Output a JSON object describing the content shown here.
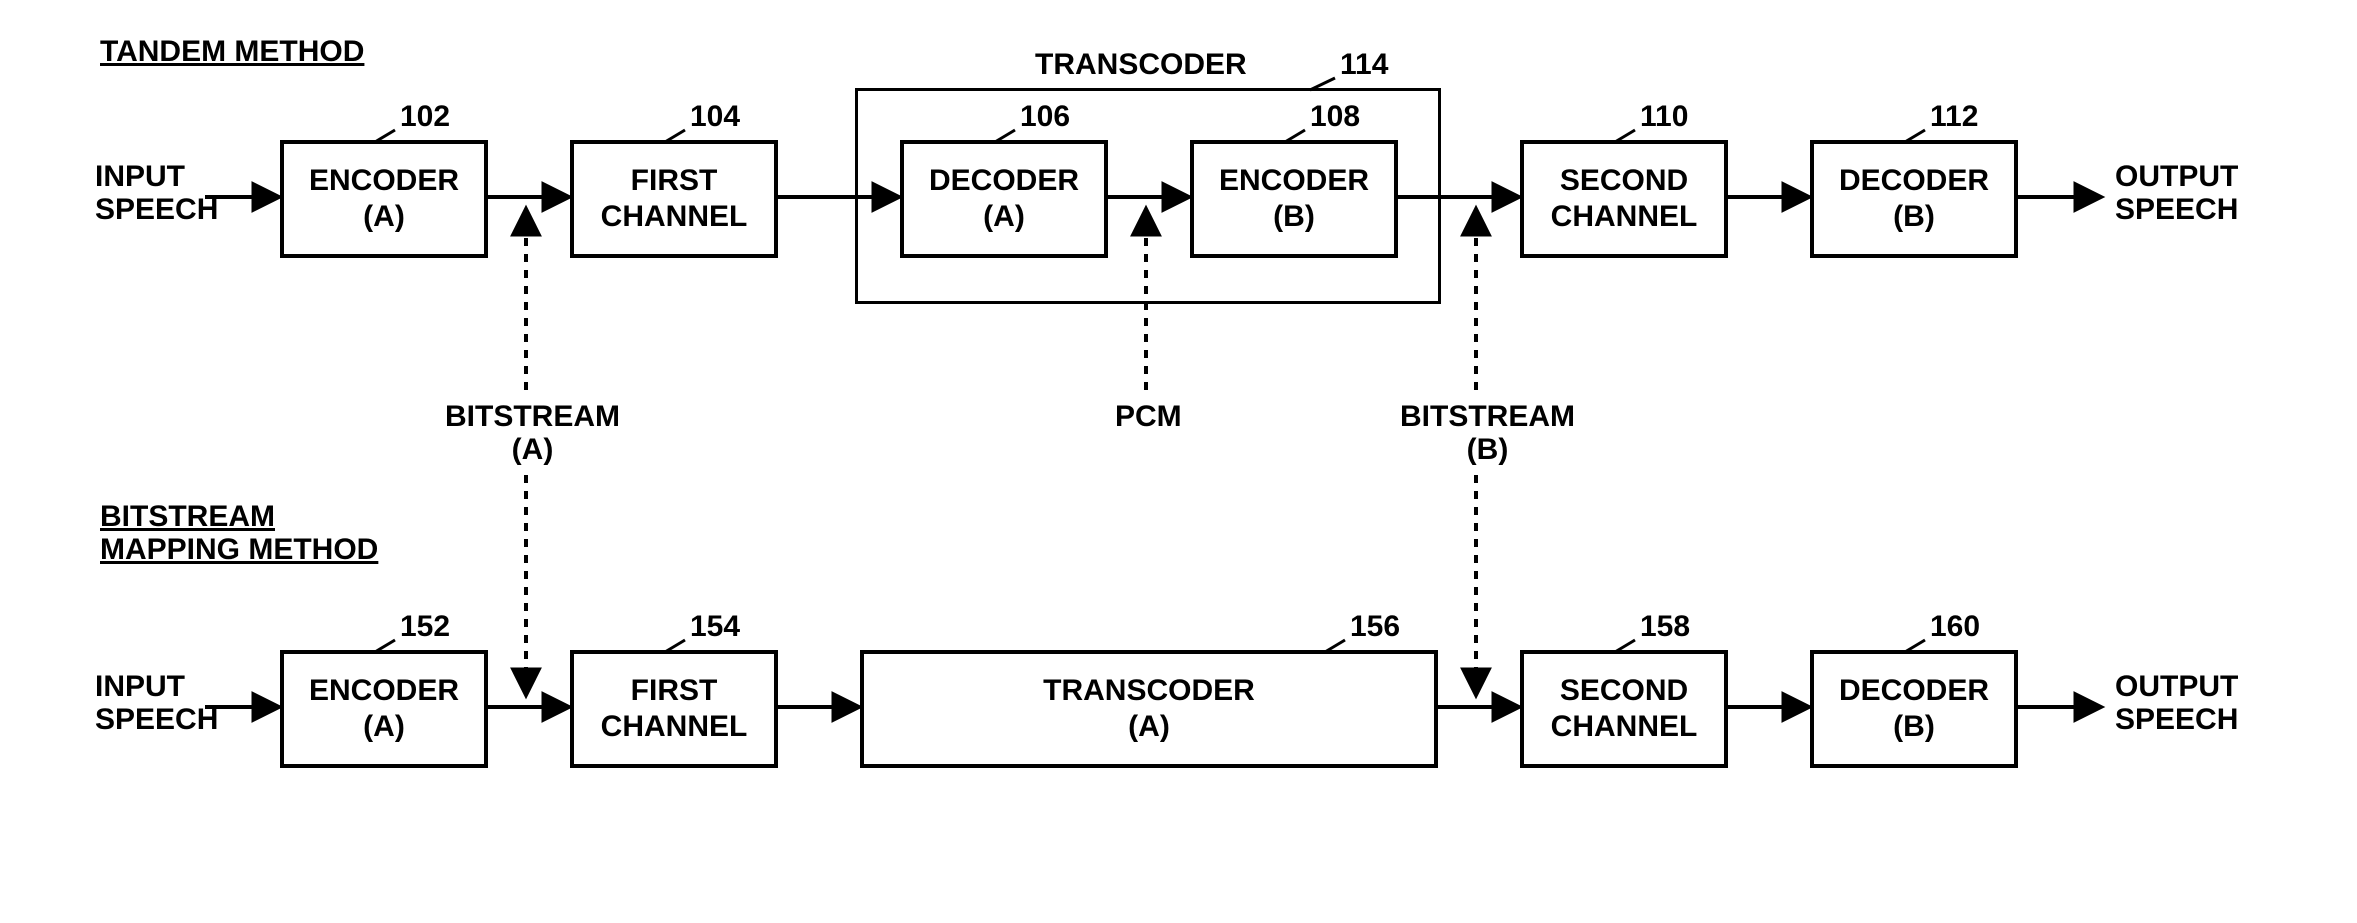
{
  "top": {
    "title": "TANDEM METHOD",
    "input": "INPUT SPEECH",
    "output": "OUTPUT SPEECH",
    "blocks": {
      "b102": {
        "num": "102",
        "l1": "ENCODER",
        "l2": "(A)"
      },
      "b104": {
        "num": "104",
        "l1": "FIRST",
        "l2": "CHANNEL"
      },
      "b106": {
        "num": "106",
        "l1": "DECODER",
        "l2": "(A)"
      },
      "b108": {
        "num": "108",
        "l1": "ENCODER",
        "l2": "(B)"
      },
      "b110": {
        "num": "110",
        "l1": "SECOND",
        "l2": "CHANNEL"
      },
      "b112": {
        "num": "112",
        "l1": "DECODER",
        "l2": "(B)"
      },
      "transcoder": {
        "num": "114",
        "label": "TRANSCODER"
      }
    }
  },
  "mid": {
    "bitstreamA": "BITSTREAM\n(A)",
    "bitstreamA_l1": "BITSTREAM",
    "bitstreamA_l2": "(A)",
    "pcm": "PCM",
    "bitstreamB_l1": "BITSTREAM",
    "bitstreamB_l2": "(B)"
  },
  "bottom": {
    "title": "BITSTREAM MAPPING METHOD",
    "input": "INPUT SPEECH",
    "output": "OUTPUT SPEECH",
    "blocks": {
      "b152": {
        "num": "152",
        "l1": "ENCODER",
        "l2": "(A)"
      },
      "b154": {
        "num": "154",
        "l1": "FIRST",
        "l2": "CHANNEL"
      },
      "b156": {
        "num": "156",
        "l1": "TRANSCODER",
        "l2": "(A)"
      },
      "b158": {
        "num": "158",
        "l1": "SECOND",
        "l2": "CHANNEL"
      },
      "b160": {
        "num": "160",
        "l1": "DECODER",
        "l2": "(B)"
      }
    }
  }
}
